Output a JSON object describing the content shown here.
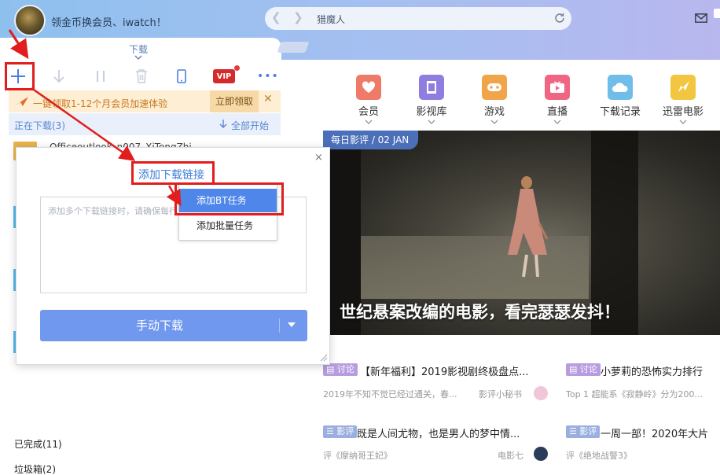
{
  "header": {
    "greeting": "领金币换会员、iwatch！",
    "search_value": "猎魔人"
  },
  "left_panel": {
    "download_tab": "下载",
    "toolbar": {
      "vip_label": "VIP"
    },
    "promo": {
      "text": "一键领取1-12个月会员加速体验",
      "button": "立即领取",
      "close": "✕"
    },
    "downloading_label": "正在下载(3)",
    "start_all": "全部开始",
    "item_name": "Officeoutlook_n007_XiTongZhi...",
    "completed": "已完成(11)",
    "trash": "垃圾箱(2)"
  },
  "popup": {
    "add_link": "添加下载链接",
    "textarea_placeholder": "添加多个下载链接时，请确保每行只有一个链接",
    "menu": [
      "添加BT任务",
      "添加批量任务"
    ],
    "manual_download": "手动下载",
    "close": "×"
  },
  "categories": [
    {
      "label": "会员",
      "color": "#f07a68"
    },
    {
      "label": "影视库",
      "color": "#8f7ee0"
    },
    {
      "label": "游戏",
      "color": "#f1a54a"
    },
    {
      "label": "直播",
      "color": "#f06582"
    },
    {
      "label": "下载记录",
      "color": "#6fbde8"
    },
    {
      "label": "迅雷电影",
      "color": "#f2c640"
    }
  ],
  "hero": {
    "badge": "每日影评 / 02 JAN",
    "title": "世纪悬案改编的电影，看完瑟瑟发抖！"
  },
  "articles": [
    {
      "tag": "讨论",
      "title": "【新年福利】2019影视剧终极盘点...",
      "sub": "2019年不知不觉已经过通关，春...",
      "author": "影评小秘书"
    },
    {
      "tag": "讨论",
      "title": "小萝莉的恐怖实力排行",
      "sub": "Top 1 超能系《寂静岭》分为200..."
    },
    {
      "tag": "影评",
      "title": "既是人间尤物，也是男人的梦中情...",
      "sub": "评《摩纳哥王妃》",
      "author": "电影七"
    },
    {
      "tag": "影评",
      "title": "一周一部！2020年大片",
      "sub": "评《绝地战警3》"
    }
  ]
}
